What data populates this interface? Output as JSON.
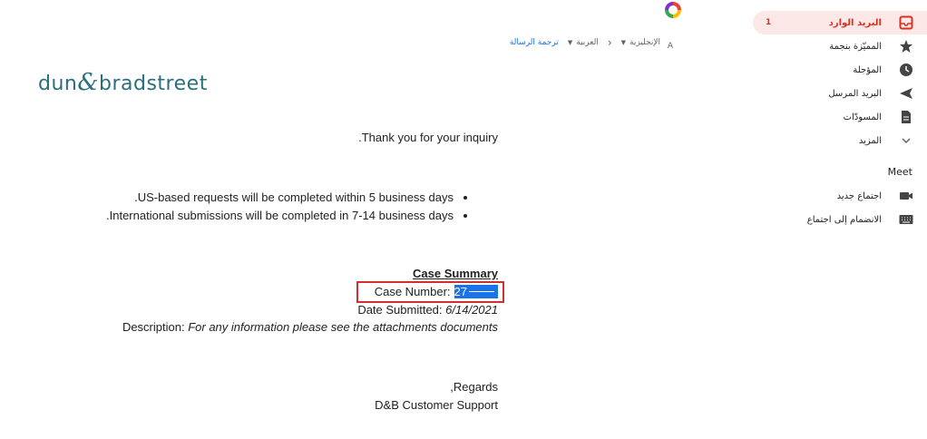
{
  "sidebar": {
    "items": [
      {
        "label": "البريد الوارد",
        "count": "1",
        "icon": "inbox-icon",
        "active": true
      },
      {
        "label": "المميّزة بنجمة",
        "icon": "star-icon"
      },
      {
        "label": "المؤجلة",
        "icon": "clock-icon"
      },
      {
        "label": "البريد المرسل",
        "icon": "send-icon"
      },
      {
        "label": "المسودّات",
        "icon": "draft-icon"
      },
      {
        "label": "المزيد",
        "icon": "chevron-down-icon"
      }
    ],
    "meet": {
      "title": "Meet",
      "items": [
        {
          "label": "اجتماع جديد",
          "icon": "video-icon"
        },
        {
          "label": "الانضمام إلى اجتماع",
          "icon": "keyboard-icon"
        }
      ]
    }
  },
  "translate": {
    "from_lang": "الإنجليزية",
    "to_lang": "العربية",
    "action": "ترجمة الرسالة"
  },
  "logo": {
    "left": "dun",
    "amp": "&",
    "right": "bradstreet"
  },
  "email": {
    "greeting": "Thank you for your inquiry.",
    "bullets": [
      "US-based requests will be completed within 5 business days.",
      "International submissions will be completed in 7-14 business days."
    ],
    "summary_title": "Case Summary",
    "case_label": "Case Number:",
    "case_value": "27",
    "date_label": "Date Submitted:",
    "date_value": "6/14/2021",
    "desc_label": "Description:",
    "desc_value": "For any information please see the attachments documents",
    "regards": "Regards,",
    "signature": "D&B Customer Support"
  },
  "colors": {
    "accent": "#d93025",
    "link": "#1a73e8",
    "logo": "#2a6f7d",
    "highlight_box": "#d32f2f"
  }
}
